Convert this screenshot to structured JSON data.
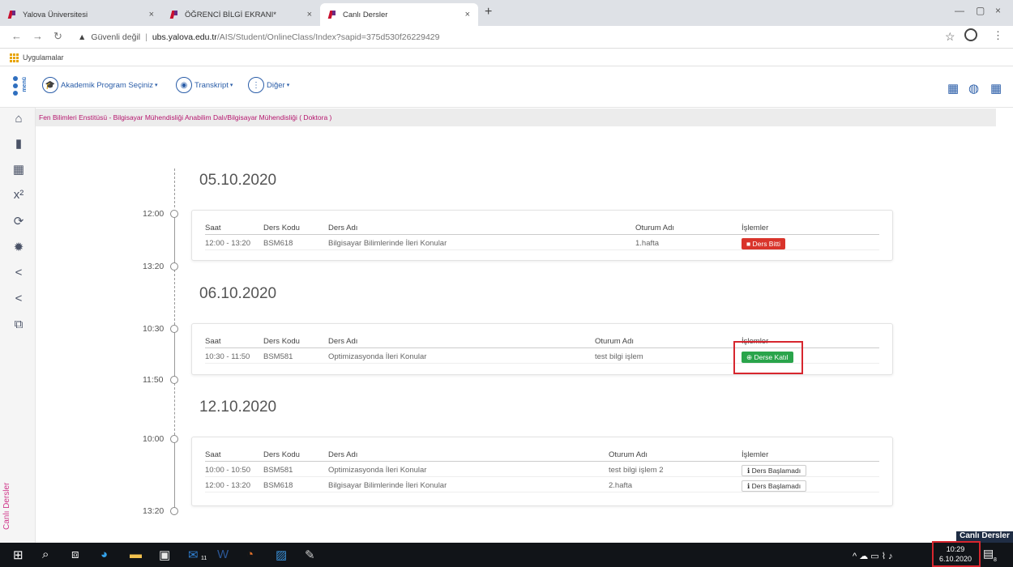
{
  "tabs": [
    {
      "title": "Yalova Üniversitesi",
      "close": "×"
    },
    {
      "title": "ÖĞRENCİ BİLGİ EKRANI*",
      "close": "×"
    },
    {
      "title": "Canlı Dersler",
      "close": "×"
    }
  ],
  "new_tab": "+",
  "window_controls": {
    "minimize": "—",
    "maximize": "▢",
    "close": "×"
  },
  "address": {
    "security": "Güvenli değil",
    "host": "ubs.yalova.edu.tr",
    "path": "/AIS/Student/OnlineClass/Index?sapid=375d530f26229429"
  },
  "bookmarks": {
    "apps": "Uygulamalar"
  },
  "topnav": {
    "logo": "menü",
    "items": [
      {
        "label": "Akademik Program Seçiniz"
      },
      {
        "label": "Transkript"
      },
      {
        "label": "Diğer"
      }
    ]
  },
  "breadcrumb": "Fen Bilimleri Enstitüsü - Bilgisayar Mühendisliği Anabilim Dalı/Bilgisayar Mühendisliği ( Doktora )",
  "sidebar": {
    "label": "Canlı Dersler",
    "superscript": "x²"
  },
  "table_headers": {
    "saat": "Saat",
    "kod": "Ders Kodu",
    "ad": "Ders Adı",
    "oturum": "Oturum Adı",
    "islem": "İşlemler"
  },
  "days": [
    {
      "date": "05.10.2020",
      "start": "12:00",
      "end": "13:20",
      "rows": [
        {
          "saat": "12:00 - 13:20",
          "kod": "BSM618",
          "ad": "Bilgisayar Bilimlerinde İleri Konular",
          "oturum": "1.hafta",
          "action": "Ders Bitti"
        }
      ]
    },
    {
      "date": "06.10.2020",
      "start": "10:30",
      "end": "11:50",
      "rows": [
        {
          "saat": "10:30 - 11:50",
          "kod": "BSM581",
          "ad": "Optimizasyonda İleri Konular",
          "oturum": "test bilgi işlem",
          "action": "Derse Katıl"
        }
      ]
    },
    {
      "date": "12.10.2020",
      "start": "10:00",
      "end": "13:20",
      "rows": [
        {
          "saat": "10:00 - 10:50",
          "kod": "BSM581",
          "ad": "Optimizasyonda İleri Konular",
          "oturum": "test bilgi işlem 2",
          "action": "Ders Başlamadı"
        },
        {
          "saat": "12:00 - 13:20",
          "kod": "BSM618",
          "ad": "Bilgisayar Bilimlerinde İleri Konular",
          "oturum": "2.hafta",
          "action": "Ders Başlamadı"
        }
      ]
    }
  ],
  "taskbar": {
    "time": "10:29",
    "date": "6.10.2020",
    "popup": "Canlı Dersler",
    "badge_11": "11",
    "badge_8": "8"
  },
  "colors": {
    "accent": "#2a5da8",
    "breadcrumb": "#b5156d",
    "red": "#d9342b",
    "green": "#2aa44b",
    "highlight": "#d7262e"
  }
}
